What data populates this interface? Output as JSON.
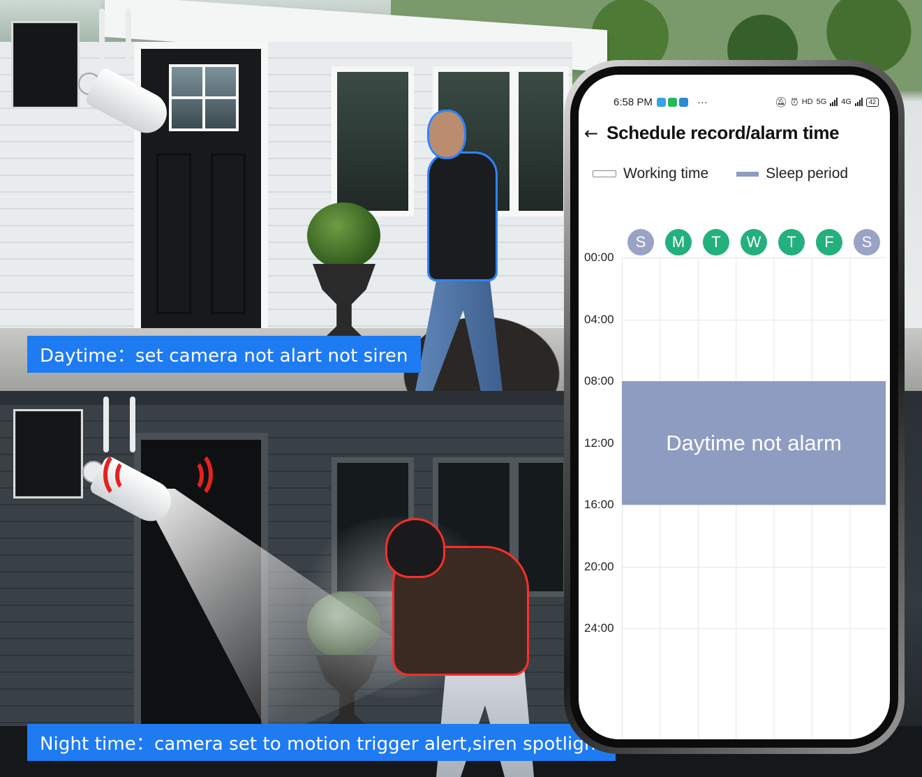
{
  "captions": {
    "day": "Daytime：set camera not alart not siren",
    "night": "Night time：camera set to motion trigger alert,siren spotlight"
  },
  "phone": {
    "status_bar": {
      "time": "6:58 PM",
      "menu": "···",
      "network1": "5G",
      "network2": "4G",
      "hd": "HD",
      "battery": "42"
    },
    "header": {
      "back_icon": "arrow-left-icon",
      "title": "Schedule record/alarm time"
    },
    "legend": {
      "working": "Working time",
      "sleep": "Sleep period"
    },
    "days": [
      {
        "label": "S",
        "active": false
      },
      {
        "label": "M",
        "active": true
      },
      {
        "label": "T",
        "active": true
      },
      {
        "label": "W",
        "active": true
      },
      {
        "label": "T",
        "active": true
      },
      {
        "label": "F",
        "active": true
      },
      {
        "label": "S",
        "active": false
      }
    ],
    "time_labels": [
      "00:00",
      "04:00",
      "08:00",
      "12:00",
      "16:00",
      "20:00",
      "24:00"
    ],
    "sleep_block": {
      "label": "Daytime not alarm",
      "start": "08:00",
      "end": "16:00"
    },
    "colors": {
      "active_day": "#23b07d",
      "inactive_day": "#9aa3c6",
      "sleep": "#8e9cc2"
    }
  }
}
